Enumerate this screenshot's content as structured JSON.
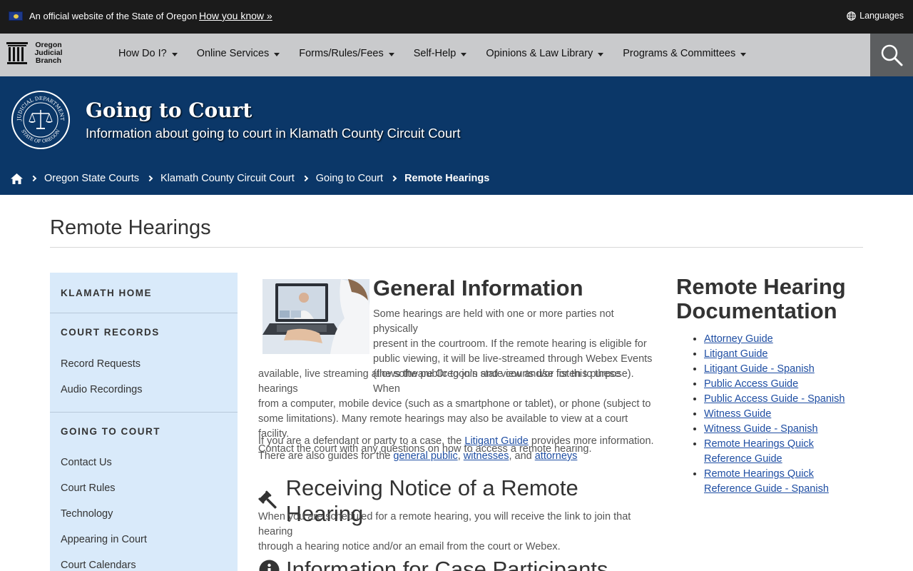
{
  "topbar": {
    "official_text": "An official website of the State of Oregon",
    "how_you_know": "How you know »",
    "languages": "Languages"
  },
  "nav": {
    "logo_text": [
      "Oregon",
      "Judicial",
      "Branch"
    ],
    "items": [
      "How Do I?",
      "Online Services",
      "Forms/Rules/Fees",
      "Self-Help",
      "Opinions & Law Library",
      "Programs & Committees"
    ]
  },
  "banner": {
    "title": "Going to Court",
    "subtitle": "Information about going to court in Klamath County Circuit Court",
    "seal_text_top": "JUDICIAL DEPARTMENT",
    "seal_text_bottom": "STATE OF OREGON"
  },
  "breadcrumb": [
    "Oregon State Courts",
    "Klamath County Circuit Court",
    "Going to Court",
    "Remote Hearings"
  ],
  "page": {
    "title": "Remote Hearings"
  },
  "sidebar": {
    "klamath_home": "KLAMATH HOME",
    "court_records": "COURT RECORDS",
    "record_requests": "Record Requests",
    "audio_recordings": "Audio Recordings",
    "going_to_court": "GOING TO COURT",
    "going_links": [
      "Contact Us",
      "Court Rules",
      "Technology",
      "Appearing in Court",
      "Court Calendars"
    ]
  },
  "main": {
    "general_heading": "General Information",
    "general_lines": [
      "Some hearings are held with one or more parties not physically",
      "present in the courtroom.  If the remote hearing is eligible for",
      "public viewing, it will be live-streamed through Webex Events",
      "(the software Oregon’s state courts use for this purpose). When",
      "available, live streaming allows the public to join and view and/or listen to these hearings",
      "from a computer, mobile device (such as a smartphone or tablet), or phone (subject to",
      "some limitations). Many remote hearings may also be available to view at a court facility.",
      "Contact the court with any questions on how to access a remote hearing."
    ],
    "guide_p1_a": "If you are a defendant or party to a case, the ",
    "guide_link_litigant": "Litigant Guide",
    "guide_p1_b": " provides more information.",
    "guide_p2_a": "There are also guides for the ",
    "guide_link_public": "general public",
    "guide_sep1": ", ",
    "guide_link_witnesses": "witnesses",
    "guide_sep2": ", and ",
    "guide_link_attorneys": "attorneys",
    "notice_heading": "Receiving Notice of a Remote Hearing",
    "notice_lines": [
      "When you are scheduled for a remote hearing, you will receive the link to join that hearing",
      "through a hearing notice and/or an email from the court or Webex."
    ],
    "participants_heading": "Information for Case Participants"
  },
  "right": {
    "title_line1": "Remote Hearing",
    "title_line2": "Documentation",
    "docs": [
      "Attorney Guide",
      "Litigant Guide",
      "Litigant Guide - Spanish",
      "Public Access Guide",
      "Public Access Guide - Spanish",
      "Witness Guide",
      "Witness Guide - Spanish",
      "Remote Hearings Quick Reference Guide",
      "Remote Hearings Quick Reference Guide - Spanish"
    ]
  },
  "colors": {
    "topbar": "#1b1b1b",
    "navbar": "#c9cacc",
    "banner": "#0b3768",
    "sidebar": "#d9eafa",
    "link": "#1f4ea3"
  },
  "icons": [
    "oregon-flag-icon",
    "globe-icon",
    "courthouse-logo-icon",
    "search-icon",
    "judicial-seal-icon",
    "home-icon",
    "chevron-right-icon",
    "gavel-icon",
    "info-icon"
  ]
}
